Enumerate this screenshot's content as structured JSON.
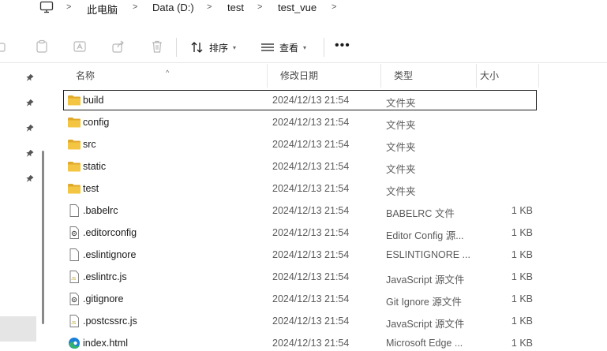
{
  "address": {
    "crumbs": [
      "此电脑",
      "Data (D:)",
      "test",
      "test_vue"
    ],
    "separator": ">"
  },
  "toolbar": {
    "sort_label": "排序",
    "view_label": "查看",
    "more_label": "•••"
  },
  "columns": {
    "name": "名称",
    "modified": "修改日期",
    "type": "类型",
    "size": "大小"
  },
  "files": [
    {
      "name": "build",
      "modified": "2024/12/13 21:54",
      "type": "文件夹",
      "size": "",
      "icon": "folder-icon"
    },
    {
      "name": "config",
      "modified": "2024/12/13 21:54",
      "type": "文件夹",
      "size": "",
      "icon": "folder-icon"
    },
    {
      "name": "src",
      "modified": "2024/12/13 21:54",
      "type": "文件夹",
      "size": "",
      "icon": "folder-icon"
    },
    {
      "name": "static",
      "modified": "2024/12/13 21:54",
      "type": "文件夹",
      "size": "",
      "icon": "folder-icon"
    },
    {
      "name": "test",
      "modified": "2024/12/13 21:54",
      "type": "文件夹",
      "size": "",
      "icon": "folder-icon"
    },
    {
      "name": ".babelrc",
      "modified": "2024/12/13 21:54",
      "type": "BABELRC 文件",
      "size": "1 KB",
      "icon": "file-icon"
    },
    {
      "name": ".editorconfig",
      "modified": "2024/12/13 21:54",
      "type": "Editor Config 源...",
      "size": "1 KB",
      "icon": "config-file-icon"
    },
    {
      "name": ".eslintignore",
      "modified": "2024/12/13 21:54",
      "type": "ESLINTIGNORE ...",
      "size": "1 KB",
      "icon": "file-icon"
    },
    {
      "name": ".eslintrc.js",
      "modified": "2024/12/13 21:54",
      "type": "JavaScript 源文件",
      "size": "1 KB",
      "icon": "js-file-icon"
    },
    {
      "name": ".gitignore",
      "modified": "2024/12/13 21:54",
      "type": "Git Ignore 源文件",
      "size": "1 KB",
      "icon": "config-file-icon"
    },
    {
      "name": ".postcssrc.js",
      "modified": "2024/12/13 21:54",
      "type": "JavaScript 源文件",
      "size": "1 KB",
      "icon": "js-file-icon"
    },
    {
      "name": "index.html",
      "modified": "2024/12/13 21:54",
      "type": "Microsoft Edge ...",
      "size": "1 KB",
      "icon": "edge-icon"
    }
  ],
  "colors": {
    "folder": "#f4c542",
    "folder_dark": "#e0a92a",
    "edge_blue": "#1a7fd6",
    "edge_green": "#34b36a"
  }
}
